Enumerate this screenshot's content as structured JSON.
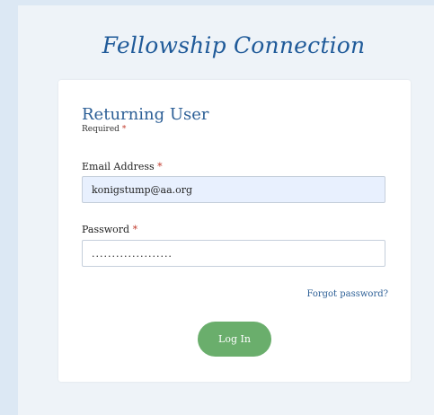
{
  "app": {
    "title": "Fellowship Connection"
  },
  "form": {
    "heading": "Returning User",
    "required_note": "Required",
    "required_marker": "*",
    "email_label": "Email Address",
    "email_value": "konigstump@aa.org",
    "password_label": "Password",
    "password_value": "....................",
    "forgot_password": "Forgot password?",
    "login_button": "Log In"
  },
  "colors": {
    "title": "#1f5a99",
    "accent_button": "#6aae6c",
    "background": "#dce8f4"
  }
}
